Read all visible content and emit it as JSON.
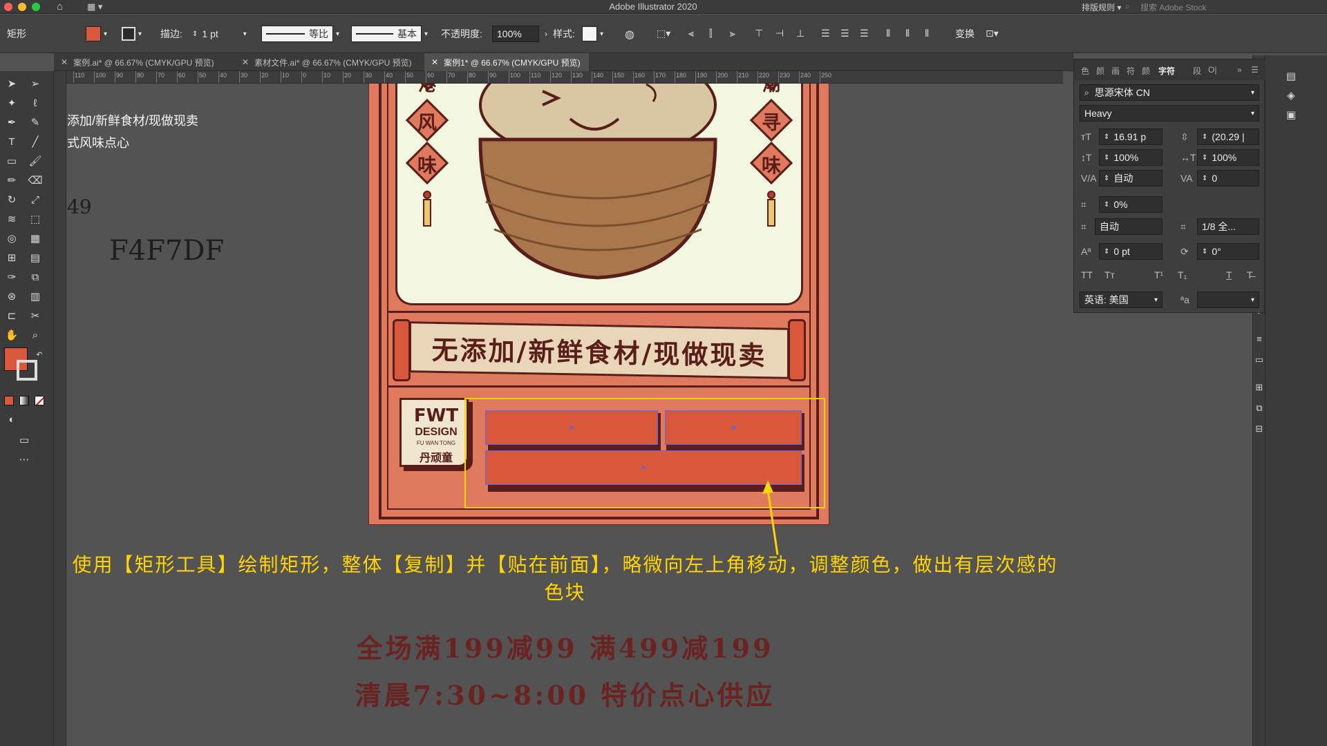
{
  "app": {
    "title": "Adobe Illustrator 2020"
  },
  "titlebar": {
    "workspace_label": "排版规则",
    "stock_placeholder": "搜索 Adobe Stock"
  },
  "control": {
    "tool_name": "矩形",
    "stroke_label": "描边:",
    "stroke_value": "1 pt",
    "profile_label": "等比",
    "brush_label": "基本",
    "opacity_label": "不透明度:",
    "opacity_value": "100%",
    "style_label": "样式:",
    "transform_label": "变换"
  },
  "tabs": [
    {
      "label": "案例.ai* @ 66.67% (CMYK/GPU 预览)",
      "active": false
    },
    {
      "label": "素材文件.ai* @ 66.67% (CMYK/GPU 预览)",
      "active": false
    },
    {
      "label": "案例1* @ 66.67% (CMYK/GPU 预览)",
      "active": true
    }
  ],
  "ruler": {
    "ticks": [
      "110",
      "100",
      "90",
      "80",
      "70",
      "60",
      "50",
      "40",
      "30",
      "20",
      "10",
      "0",
      "10",
      "20",
      "30",
      "40",
      "50",
      "60",
      "70",
      "80",
      "90",
      "100",
      "110",
      "120",
      "130",
      "140",
      "150",
      "160",
      "170",
      "180",
      "190",
      "200",
      "210",
      "220",
      "230",
      "240",
      "250"
    ]
  },
  "canvas": {
    "left_text_1": "添加/新鲜食材/现做现卖",
    "left_text_2": "式风味点心",
    "left_number": "49",
    "hex_color": "F4F7DF",
    "poster": {
      "left_chars": [
        "港",
        "风",
        "味"
      ],
      "right_chars": [
        "潮",
        "寻",
        "味"
      ],
      "banner_text": "无添加/新鲜食材/现做现卖",
      "logo_line1": "FWT",
      "logo_line2": "DESIGN",
      "logo_line3": "FU WAN TONG",
      "logo_line4": "丹顽童"
    },
    "caption": "使用【矩形工具】绘制矩形，整体【复制】并【贴在前面】，略微向左上角移动，调整颜色，做出有层次感的色块",
    "promo_line1": "全场满199减99 满499减199",
    "promo_line2": "清晨7:30~8:00 特价点心供应"
  },
  "character_panel": {
    "tabs": [
      "色",
      "颜",
      "画",
      "符",
      "颜",
      "字符",
      "段",
      "O|"
    ],
    "font_family": "思源宋体 CN",
    "font_style": "Heavy",
    "font_size": "16.91 p",
    "leading": "(20.29 |",
    "vertical_scale": "100%",
    "horizontal_scale": "100%",
    "kerning": "自动",
    "tracking": "0",
    "tsume": "0%",
    "aki_left": "自动",
    "aki_right": "1/8 全...",
    "baseline_shift": "0 pt",
    "rotation": "0°",
    "language": "英语: 美国"
  },
  "colors": {
    "accent_red": "#D9573A",
    "poster_bg": "#E07A5F",
    "dark_brown": "#5A1E1A",
    "cream": "#F4F7DF",
    "caption_yellow": "#FFD400",
    "selection_blue": "#4A6CFF"
  }
}
